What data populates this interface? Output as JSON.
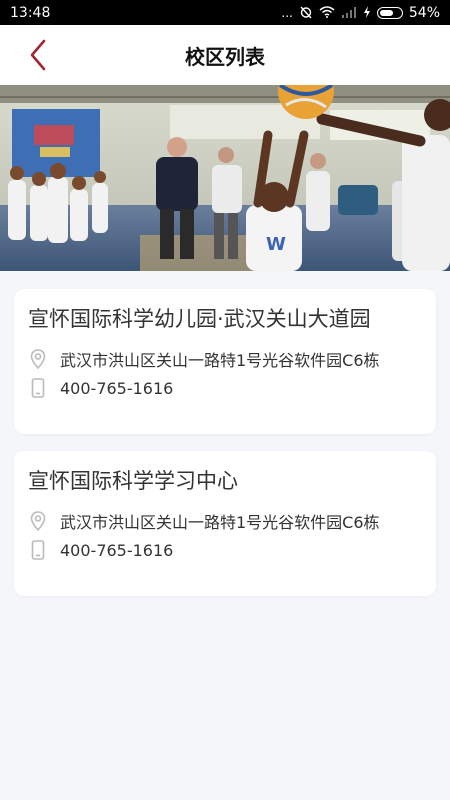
{
  "status_bar": {
    "time": "13:48",
    "dots": "...",
    "battery": "54%"
  },
  "header": {
    "title": "校区列表"
  },
  "campuses": [
    {
      "name": "宣怀国际科学幼儿园·武汉关山大道园",
      "address": "武汉市洪山区关山一路特1号光谷软件园C6栋",
      "phone": "400-765-1616"
    },
    {
      "name": "宣怀国际科学学习中心",
      "address": "武汉市洪山区关山一路特1号光谷软件园C6栋",
      "phone": "400-765-1616"
    }
  ],
  "colors": {
    "accent": "#a3262f",
    "page_bg": "#f4f6f9",
    "icon_gray": "#bbbbbb"
  }
}
